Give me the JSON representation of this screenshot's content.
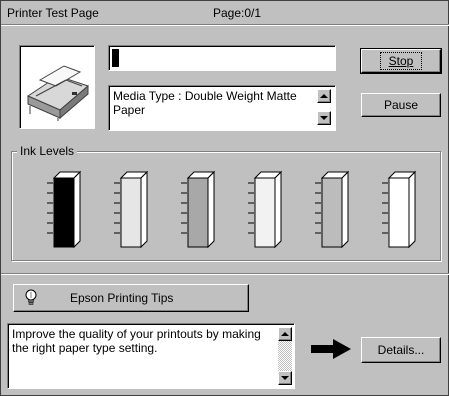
{
  "title_bar": {
    "label": "Printer Test Page",
    "page": "Page:0/1"
  },
  "buttons": {
    "stop": "Stop",
    "pause": "Pause",
    "details": "Details..."
  },
  "progress": {
    "fraction": 0.03
  },
  "media": {
    "text": "Media Type : Double Weight Matte Paper"
  },
  "ink_levels": {
    "title": "Ink Levels",
    "cartridges": [
      {
        "name": "black",
        "color": "#000000"
      },
      {
        "name": "light-gray-1",
        "color": "#e6e6e6"
      },
      {
        "name": "gray",
        "color": "#a8a8a8"
      },
      {
        "name": "very-light",
        "color": "#f2f2f2"
      },
      {
        "name": "mid-gray",
        "color": "#bcbcbc"
      },
      {
        "name": "white",
        "color": "#ffffff"
      }
    ]
  },
  "tips": {
    "button_label": "Epson Printing Tips",
    "message": "Improve the quality of your printouts by making the right paper type setting."
  },
  "icons": {
    "printer": "printer-icon",
    "bulb": "lightbulb-icon",
    "arrow": "arrow-right-icon"
  }
}
